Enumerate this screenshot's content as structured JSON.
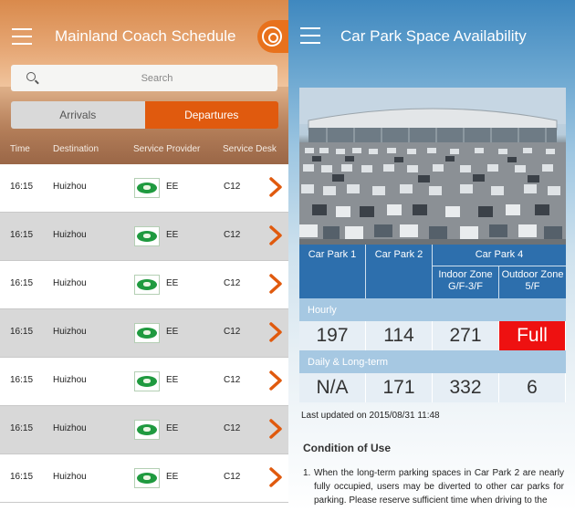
{
  "left": {
    "title": "Mainland Coach Schedule",
    "search_placeholder": "Search",
    "tabs": [
      "Arrivals",
      "Departures"
    ],
    "columns": [
      "Time",
      "Destination",
      "Service Provider",
      "Service Desk"
    ],
    "rows": [
      {
        "time": "16:15",
        "destination": "Huizhou",
        "provider": "EE",
        "desk": "C12"
      },
      {
        "time": "16:15",
        "destination": "Huizhou",
        "provider": "EE",
        "desk": "C12"
      },
      {
        "time": "16:15",
        "destination": "Huizhou",
        "provider": "EE",
        "desk": "C12"
      },
      {
        "time": "16:15",
        "destination": "Huizhou",
        "provider": "EE",
        "desk": "C12"
      },
      {
        "time": "16:15",
        "destination": "Huizhou",
        "provider": "EE",
        "desk": "C12"
      },
      {
        "time": "16:15",
        "destination": "Huizhou",
        "provider": "EE",
        "desk": "C12"
      },
      {
        "time": "16:15",
        "destination": "Huizhou",
        "provider": "EE",
        "desk": "C12"
      }
    ],
    "logo_text": "E+E",
    "accent_color": "#e05a0e"
  },
  "right": {
    "title": "Car Park Space Availability",
    "header": {
      "cp1": "Car Park 1",
      "cp2": "Car Park 2",
      "cp4": "Car Park 4",
      "indoor": "Indoor Zone",
      "indoor_sub": "G/F-3/F",
      "outdoor": "Outdoor Zone",
      "outdoor_sub": "5/F"
    },
    "hourly_label": "Hourly",
    "hourly": [
      "197",
      "114",
      "271",
      "Full"
    ],
    "daily_label": "Daily & Long-term",
    "daily": [
      "N/A",
      "171",
      "332",
      "6"
    ],
    "updated": "Last updated on 2015/08/31 11:48",
    "condition_title": "Condition of Use",
    "condition_num": "1.",
    "condition_text": "When the long-term parking spaces in Car Park 2 are nearly fully occupied, users may be diverted to other car parks for parking. Please reserve sufficient time when driving to the",
    "full_color": "#ee1111",
    "header_color": "#2d6fad"
  }
}
